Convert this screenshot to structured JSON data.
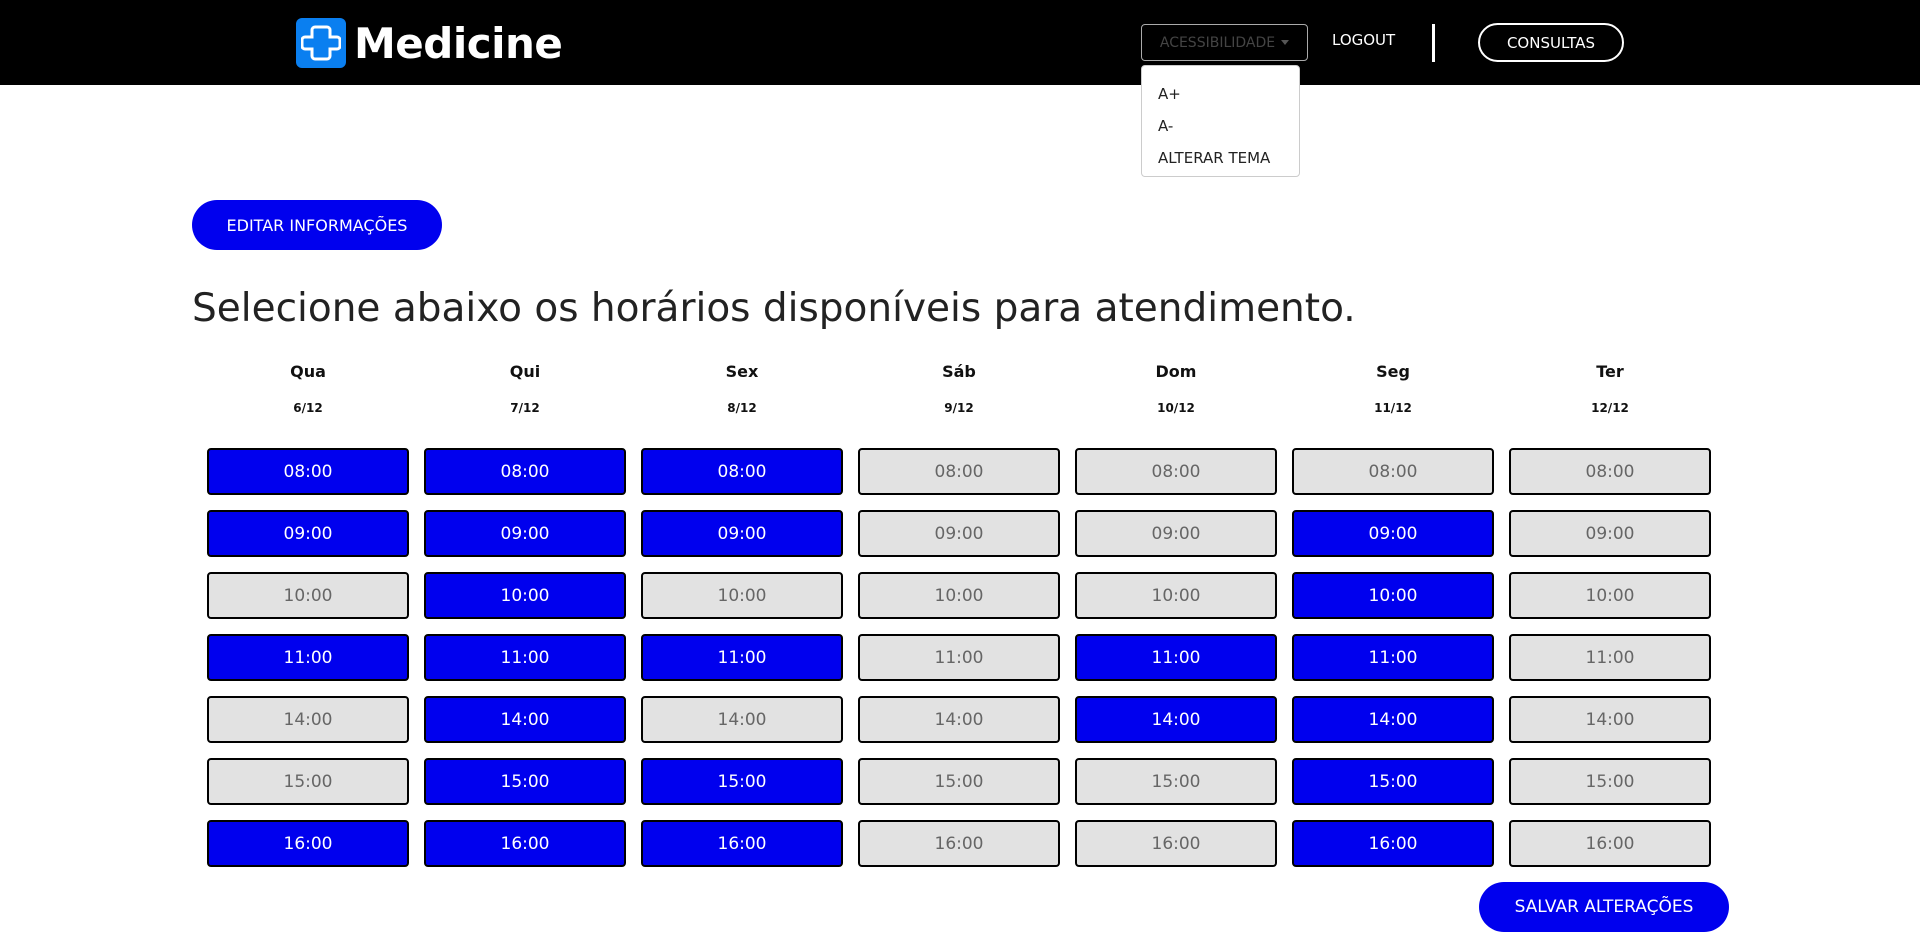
{
  "header": {
    "brand_name": "Medicine",
    "accessibility_label": "ACESSIBILIDADE",
    "logout_label": "LOGOUT",
    "consultas_label": "CONSULTAS"
  },
  "accessibility_menu": {
    "items": [
      "A+",
      "A-",
      "ALTERAR TEMA"
    ]
  },
  "main": {
    "edit_label": "EDITAR INFORMAÇÕES",
    "heading": "Selecione abaixo os horários disponíveis para atendimento.",
    "save_label": "SALVAR ALTERAÇÕES"
  },
  "schedule": {
    "days": [
      {
        "name": "Qua",
        "date": "6/12"
      },
      {
        "name": "Qui",
        "date": "7/12"
      },
      {
        "name": "Sex",
        "date": "8/12"
      },
      {
        "name": "Sáb",
        "date": "9/12"
      },
      {
        "name": "Dom",
        "date": "10/12"
      },
      {
        "name": "Seg",
        "date": "11/12"
      },
      {
        "name": "Ter",
        "date": "12/12"
      }
    ],
    "times": [
      "08:00",
      "09:00",
      "10:00",
      "11:00",
      "14:00",
      "15:00",
      "16:00"
    ],
    "selected": [
      [
        true,
        true,
        true,
        false,
        false,
        false,
        false
      ],
      [
        true,
        true,
        true,
        false,
        false,
        true,
        false
      ],
      [
        false,
        true,
        false,
        false,
        false,
        true,
        false
      ],
      [
        true,
        true,
        true,
        false,
        true,
        true,
        false
      ],
      [
        false,
        true,
        false,
        false,
        true,
        true,
        false
      ],
      [
        false,
        true,
        true,
        false,
        false,
        true,
        false
      ],
      [
        true,
        true,
        true,
        false,
        false,
        true,
        false
      ]
    ]
  },
  "colors": {
    "selected_bg": "#0000ee",
    "unselected_bg": "#e2e2e2",
    "brand_icon": "#0a7ff0"
  }
}
